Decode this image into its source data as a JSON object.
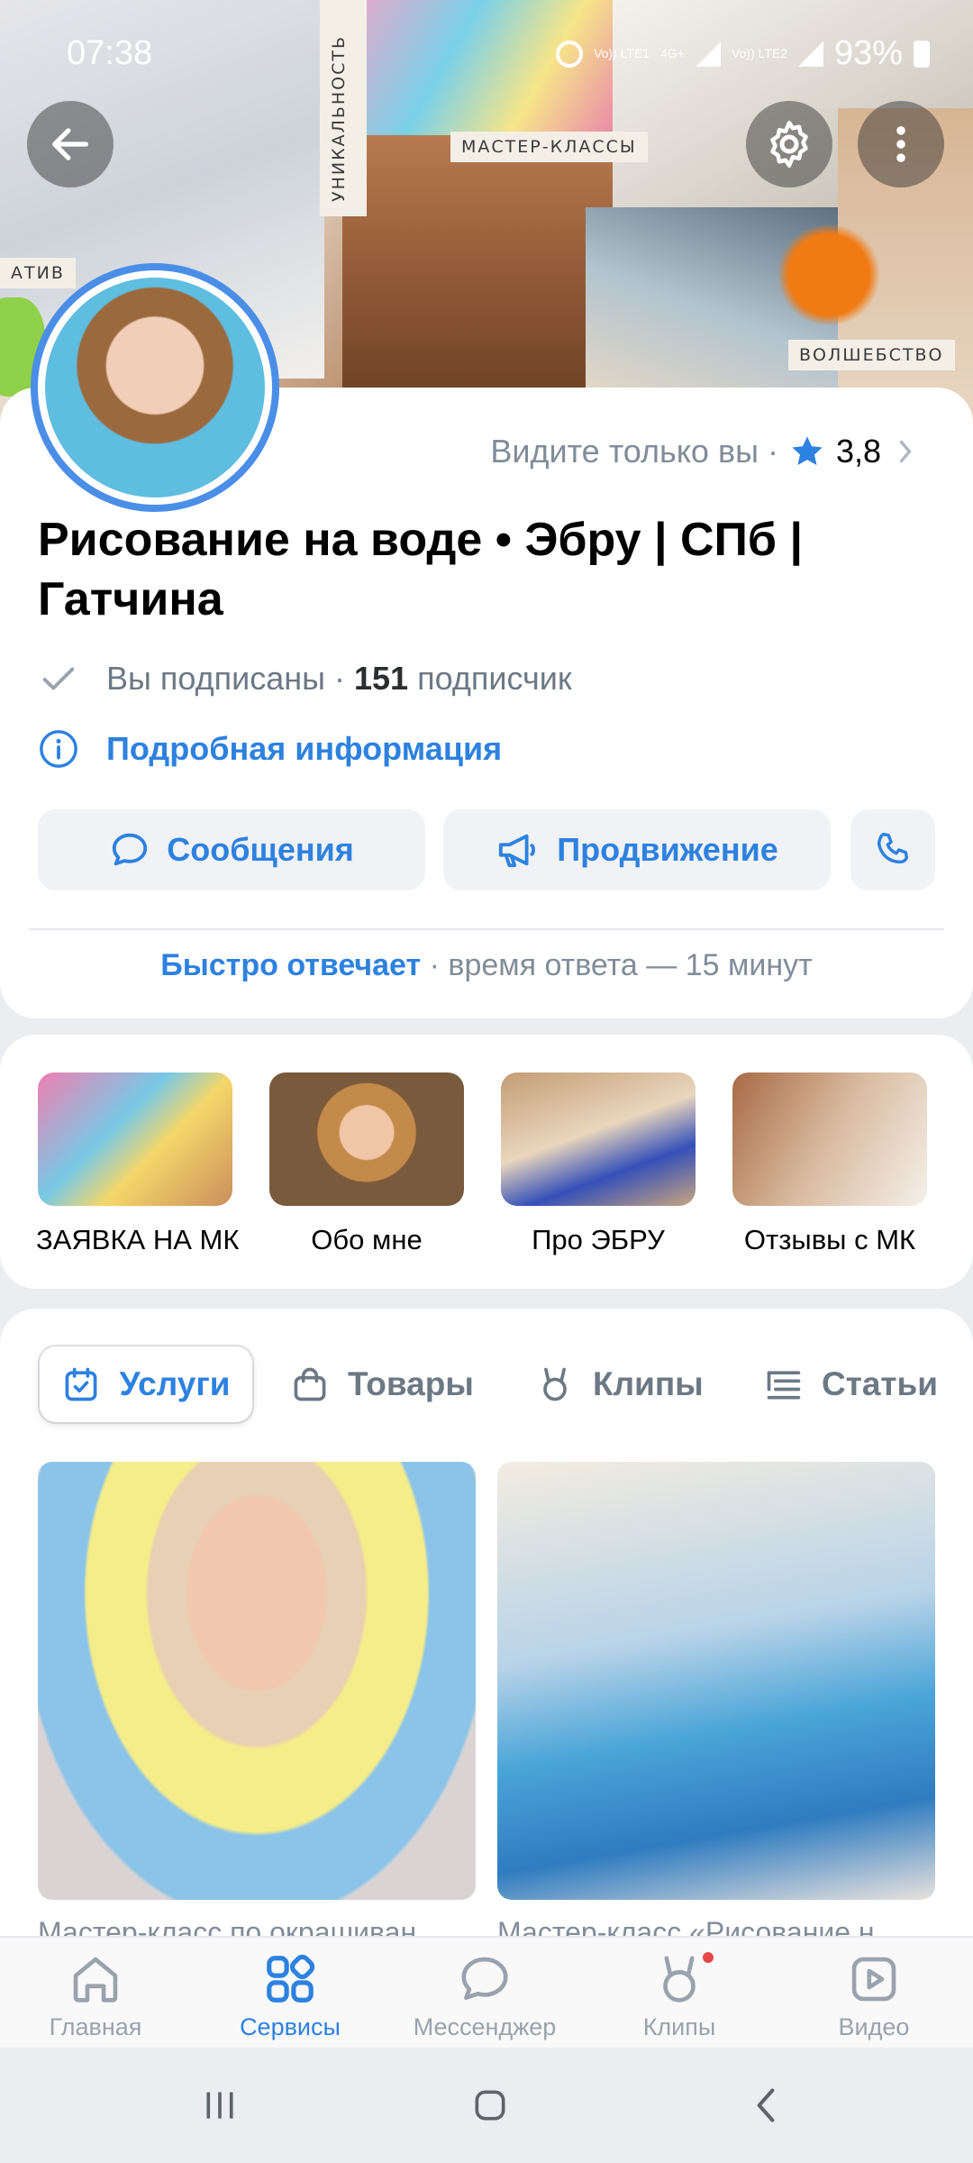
{
  "status_bar": {
    "time": "07:38",
    "network1": "Vo)) LTE1",
    "network_type": "4G+",
    "network2": "Vo)) LTE2",
    "battery": "93%"
  },
  "cover": {
    "labels": {
      "master_classes": "МАСТЕР-КЛАССЫ",
      "uniqueness": "УНИКАЛЬНОСТЬ",
      "magic": "ВОЛШЕБСТВО",
      "creative": "АТИВ"
    }
  },
  "header": {
    "visibility_text": "Видите только вы ·",
    "rating": "3,8",
    "title": "Рисование на воде • Эбру | СПб | Гатчина",
    "subscribed_text": "Вы подписаны ·",
    "subscribers_count": "151",
    "subscribers_word": "подписчик",
    "details_link": "Подробная информация",
    "buttons": {
      "messages": "Сообщения",
      "promotion": "Продвижение"
    },
    "quick_reply_accent": "Быстро отвечает",
    "quick_reply_rest": "· время ответа — 15 минут"
  },
  "shortcuts": [
    {
      "label": "ЗАЯВКА НА МК"
    },
    {
      "label": "Обо мне"
    },
    {
      "label": "Про ЭБРУ"
    },
    {
      "label": "Отзывы с МК"
    }
  ],
  "tabs": {
    "services": "Услуги",
    "goods": "Товары",
    "clips": "Клипы",
    "articles": "Статьи"
  },
  "products": [
    {
      "name": "Мастер-класс по окрашиван"
    },
    {
      "name": "Мастер-класс «Рисование н"
    }
  ],
  "bottom_nav": {
    "home": "Главная",
    "services": "Сервисы",
    "messenger": "Мессенджер",
    "clips": "Клипы",
    "video": "Видео"
  },
  "colors": {
    "accent": "#2d81e0",
    "background": "#ebedf0",
    "secondary_text": "#818c99",
    "badge": "#e64646"
  }
}
